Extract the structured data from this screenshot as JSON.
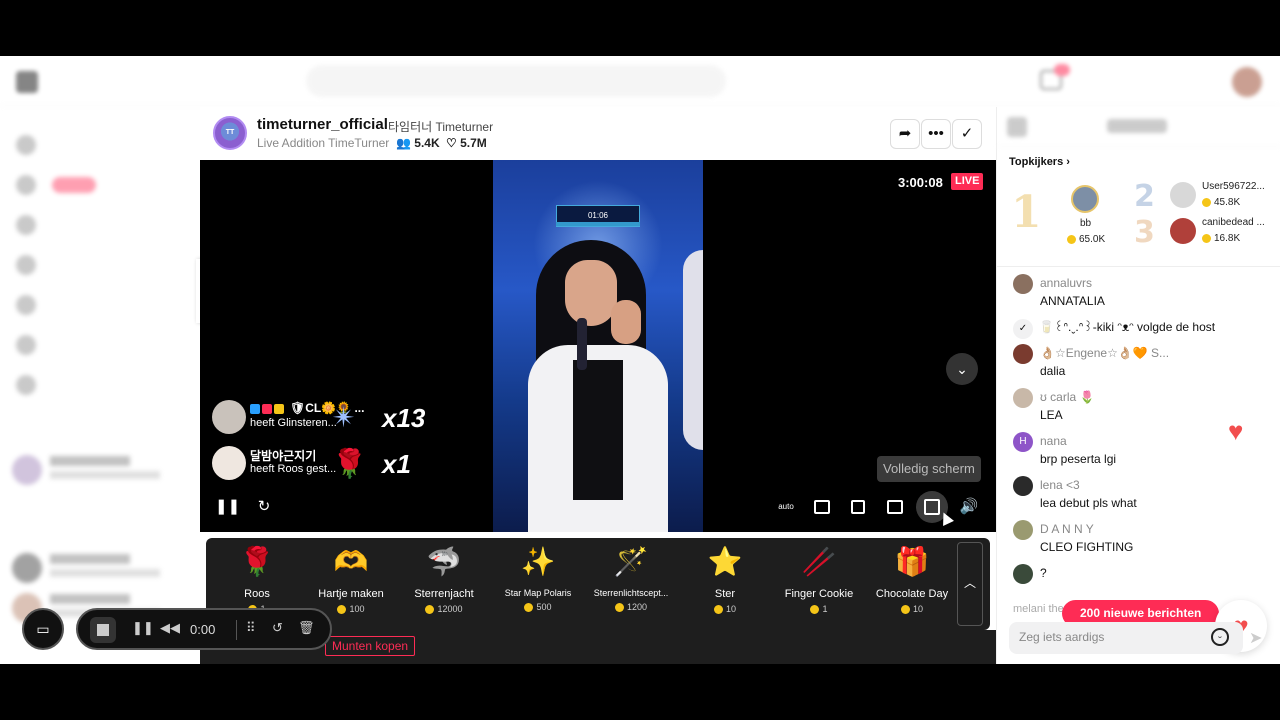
{
  "stream": {
    "host_name": "timeturner_official",
    "host_sub": "타임터너 Timeturner",
    "live_title": "Live Addition TimeTurner",
    "viewers": "5.4K",
    "likes": "5.7M",
    "timer": "3:00:08",
    "live_label": "LIVE",
    "score_label": "01:06"
  },
  "gift_notifications": [
    {
      "name": "🛡CL🌼🌻 ...",
      "action": "heeft Glinsteren...",
      "icon": "✴",
      "count": "x13"
    },
    {
      "name": "달밤야근지기",
      "action": "heeft Roos gest...",
      "icon": "🌹",
      "count": "x1"
    }
  ],
  "player": {
    "fullscreen_tooltip": "Volledig scherm",
    "auto_label": "auto"
  },
  "gifts": [
    {
      "icon": "🌹",
      "label": "Roos",
      "price": "1"
    },
    {
      "icon": "🫶",
      "label": "Hartje maken",
      "price": "100"
    },
    {
      "icon": "🦈",
      "label": "Sterrenjacht",
      "price": "12000"
    },
    {
      "icon": "✨",
      "label": "Star Map Polaris",
      "price": "500"
    },
    {
      "icon": "🪄",
      "label": "Sterrenlichtscept...",
      "price": "1200"
    },
    {
      "icon": "⭐",
      "label": "Ster",
      "price": "10"
    },
    {
      "icon": "🥢",
      "label": "Finger Cookie",
      "price": "1"
    },
    {
      "icon": "🎁",
      "label": "Chocolate Day",
      "price": "10"
    }
  ],
  "buy_coins": "Munten kopen",
  "recorder": {
    "time": "0:00"
  },
  "top_viewers": {
    "heading": "Topkijkers",
    "first": {
      "rank": "1",
      "name": "bb",
      "coins": "65.0K"
    },
    "second": {
      "rank": "2",
      "name": "User596722...",
      "coins": "45.8K"
    },
    "third": {
      "rank": "3",
      "name": "canibedead ...",
      "coins": "16.8K"
    }
  },
  "chat": [
    {
      "name": "annaluvrs",
      "text": "ANNATALIA"
    },
    {
      "name": "👌🏼☆Engene☆👌🏼🧡 S...",
      "text": "dalia"
    },
    {
      "name": "ʊ  carla  🌷",
      "text": "LEA"
    },
    {
      "name": "nana",
      "text": "brp peserta lgi"
    },
    {
      "name": "lena <3",
      "text": "lea debut pls what"
    },
    {
      "name": "D A N N Y",
      "text": "CLEO FIGHTING"
    },
    {
      "name": "",
      "text": "?"
    }
  ],
  "follow_event": "🥛꒰ᐢ.ˬ.ᐢ꒱-kiki ᵔᴥᵔ volgde de host",
  "faded_chat": "melani the poemt deel",
  "new_messages": "200 nieuwe berichten",
  "chat_placeholder": "Zeg iets aardigs",
  "colors": {
    "accent": "#fe2c55",
    "coin": "#f5c518",
    "heart": "#f24e4e"
  }
}
